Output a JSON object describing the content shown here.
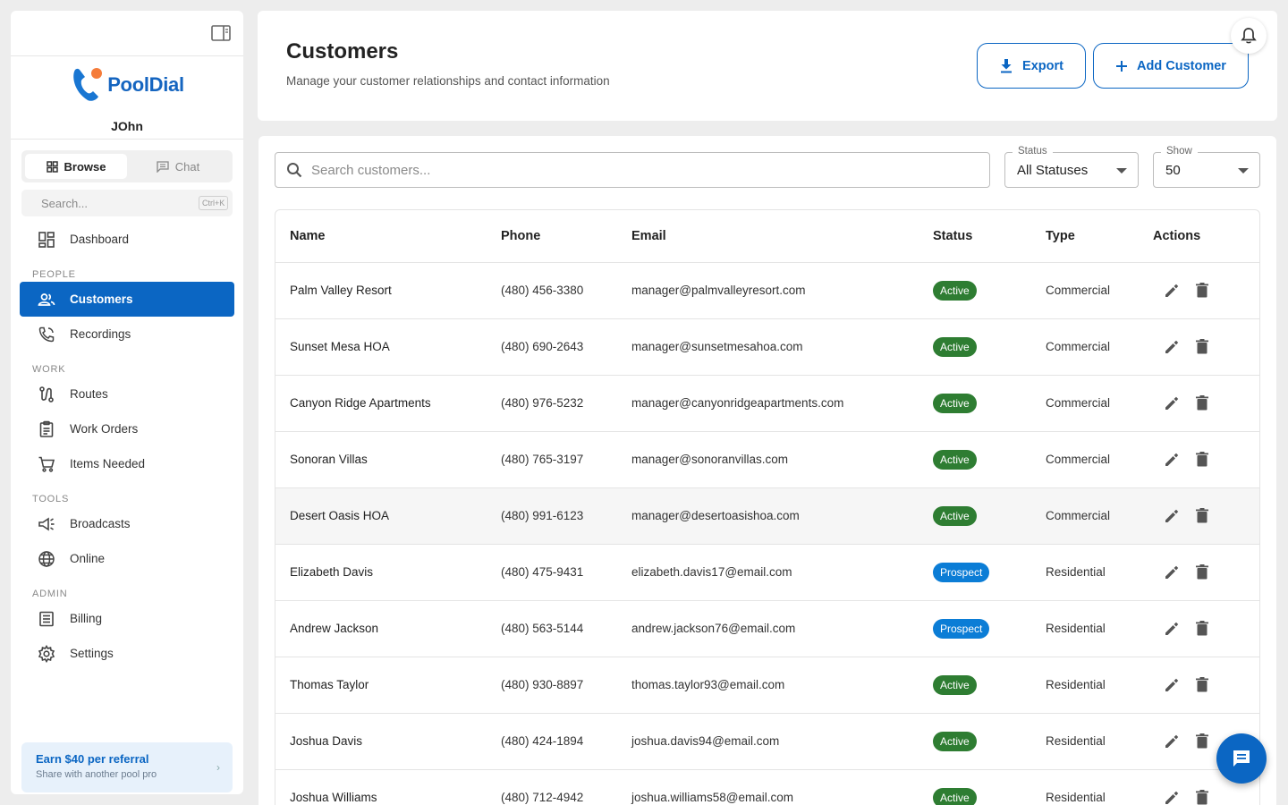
{
  "app": {
    "name": "PoolDial",
    "user": "JOhn"
  },
  "sidebar": {
    "segments": [
      {
        "label": "Browse",
        "active": true
      },
      {
        "label": "Chat",
        "active": false
      }
    ],
    "search": {
      "placeholder": "Search...",
      "shortcut": "Ctrl+K"
    },
    "dashboard": {
      "label": "Dashboard",
      "icon": "dashboard-icon"
    },
    "sections": {
      "people": "PEOPLE",
      "work": "WORK",
      "tools": "TOOLS",
      "admin": "ADMIN"
    },
    "items": {
      "customers": {
        "label": "Customers",
        "icon": "people-icon"
      },
      "recordings": {
        "label": "Recordings",
        "icon": "phone-icon"
      },
      "routes": {
        "label": "Routes",
        "icon": "route-icon"
      },
      "work_orders": {
        "label": "Work Orders",
        "icon": "clipboard-icon"
      },
      "items_needed": {
        "label": "Items Needed",
        "icon": "cart-icon"
      },
      "broadcasts": {
        "label": "Broadcasts",
        "icon": "megaphone-icon"
      },
      "online": {
        "label": "Online",
        "icon": "globe-icon"
      },
      "billing": {
        "label": "Billing",
        "icon": "list-icon"
      },
      "settings": {
        "label": "Settings",
        "icon": "gear-icon"
      }
    },
    "referral": {
      "title": "Earn $40 per referral",
      "subtitle": "Share with another pool pro",
      "arrow": "›"
    }
  },
  "header": {
    "title": "Customers",
    "subtitle": "Manage your customer relationships and contact information",
    "export_label": "Export",
    "add_label": "Add Customer"
  },
  "filters": {
    "search_placeholder": "Search customers...",
    "status_label": "Status",
    "status_value": "All Statuses",
    "show_label": "Show",
    "show_value": "50"
  },
  "table": {
    "columns": [
      "Name",
      "Phone",
      "Email",
      "Status",
      "Type",
      "Actions"
    ],
    "rows": [
      {
        "name": "Palm Valley Resort",
        "phone": "(480) 456-3380",
        "email": "manager@palmvalleyresort.com",
        "status": "Active",
        "type": "Commercial"
      },
      {
        "name": "Sunset Mesa HOA",
        "phone": "(480) 690-2643",
        "email": "manager@sunsetmesahoa.com",
        "status": "Active",
        "type": "Commercial"
      },
      {
        "name": "Canyon Ridge Apartments",
        "phone": "(480) 976-5232",
        "email": "manager@canyonridgeapartments.com",
        "status": "Active",
        "type": "Commercial"
      },
      {
        "name": "Sonoran Villas",
        "phone": "(480) 765-3197",
        "email": "manager@sonoranvillas.com",
        "status": "Active",
        "type": "Commercial"
      },
      {
        "name": "Desert Oasis HOA",
        "phone": "(480) 991-6123",
        "email": "manager@desertoasishoa.com",
        "status": "Active",
        "type": "Commercial"
      },
      {
        "name": "Elizabeth Davis",
        "phone": "(480) 475-9431",
        "email": "elizabeth.davis17@email.com",
        "status": "Prospect",
        "type": "Residential"
      },
      {
        "name": "Andrew Jackson",
        "phone": "(480) 563-5144",
        "email": "andrew.jackson76@email.com",
        "status": "Prospect",
        "type": "Residential"
      },
      {
        "name": "Thomas Taylor",
        "phone": "(480) 930-8897",
        "email": "thomas.taylor93@email.com",
        "status": "Active",
        "type": "Residential"
      },
      {
        "name": "Joshua Davis",
        "phone": "(480) 424-1894",
        "email": "joshua.davis94@email.com",
        "status": "Active",
        "type": "Residential"
      },
      {
        "name": "Joshua Williams",
        "phone": "(480) 712-4942",
        "email": "joshua.williams58@email.com",
        "status": "Active",
        "type": "Residential"
      }
    ]
  },
  "colors": {
    "accent": "#0b66c3",
    "active_badge": "#2e7d32",
    "prospect_badge": "#0b7dd6",
    "logo_orange": "#f57c3a"
  }
}
